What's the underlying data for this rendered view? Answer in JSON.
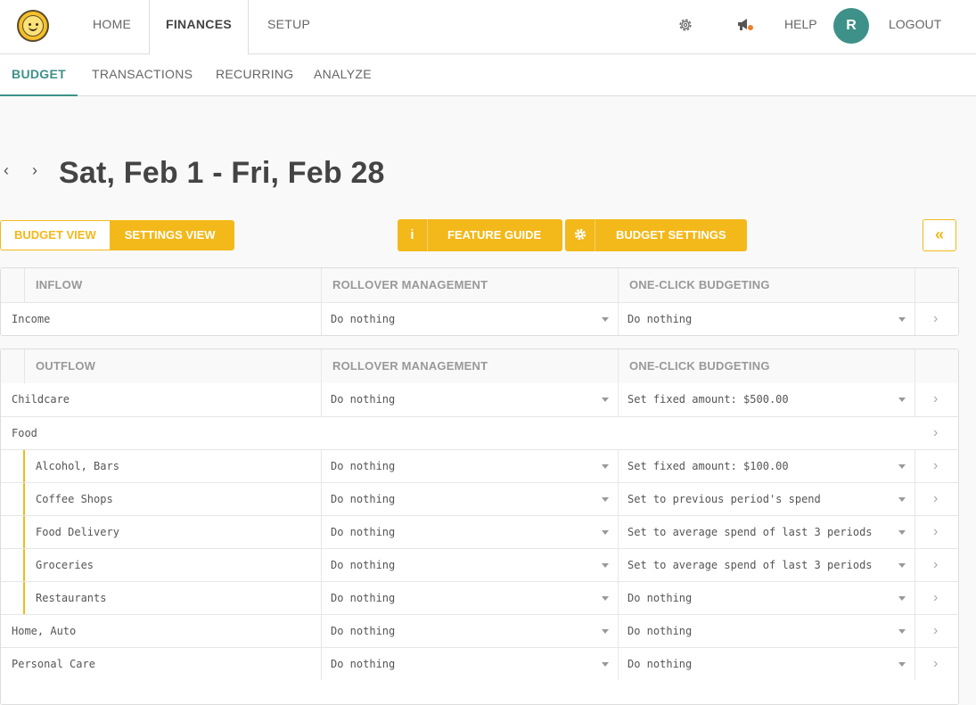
{
  "topnav": {
    "tabs": [
      "HOME",
      "FINANCES",
      "SETUP"
    ],
    "help": "HELP",
    "avatar": "R",
    "logout": "LOGOUT"
  },
  "subnav": {
    "tabs": [
      "BUDGET",
      "TRANSACTIONS",
      "RECURRING",
      "ANALYZE"
    ]
  },
  "period": {
    "title": "Sat, Feb 1 - Fri, Feb 28"
  },
  "toolbar": {
    "budget_view": "BUDGET VIEW",
    "settings_view": "SETTINGS VIEW",
    "feature_guide": "FEATURE GUIDE",
    "feature_guide_icon": "i",
    "budget_settings": "BUDGET SETTINGS",
    "collapse": "«"
  },
  "inflow": {
    "headers": [
      "INFLOW",
      "ROLLOVER MANAGEMENT",
      "ONE-CLICK BUDGETING"
    ],
    "rows": [
      {
        "name": "Income",
        "rollover": "Do nothing",
        "budgeting": "Do nothing"
      }
    ]
  },
  "outflow": {
    "headers": [
      "OUTFLOW",
      "ROLLOVER MANAGEMENT",
      "ONE-CLICK BUDGETING"
    ],
    "rows": [
      {
        "name": "Childcare",
        "rollover": "Do nothing",
        "budgeting": "Set fixed amount: $500.00"
      },
      {
        "name": "Food",
        "rollover": "",
        "budgeting": ""
      },
      {
        "name": "Alcohol, Bars",
        "rollover": "Do nothing",
        "budgeting": "Set fixed amount: $100.00"
      },
      {
        "name": "Coffee Shops",
        "rollover": "Do nothing",
        "budgeting": "Set to previous period's spend"
      },
      {
        "name": "Food Delivery",
        "rollover": "Do nothing",
        "budgeting": "Set to average spend of last 3 periods"
      },
      {
        "name": "Groceries",
        "rollover": "Do nothing",
        "budgeting": "Set to average spend of last 3 periods"
      },
      {
        "name": "Restaurants",
        "rollover": "Do nothing",
        "budgeting": "Do nothing"
      },
      {
        "name": "Home, Auto",
        "rollover": "Do nothing",
        "budgeting": "Do nothing"
      },
      {
        "name": "Personal Care",
        "rollover": "Do nothing",
        "budgeting": "Do nothing"
      }
    ]
  },
  "colors": {
    "accent": "#f3b81a",
    "teal": "#3e9188"
  }
}
